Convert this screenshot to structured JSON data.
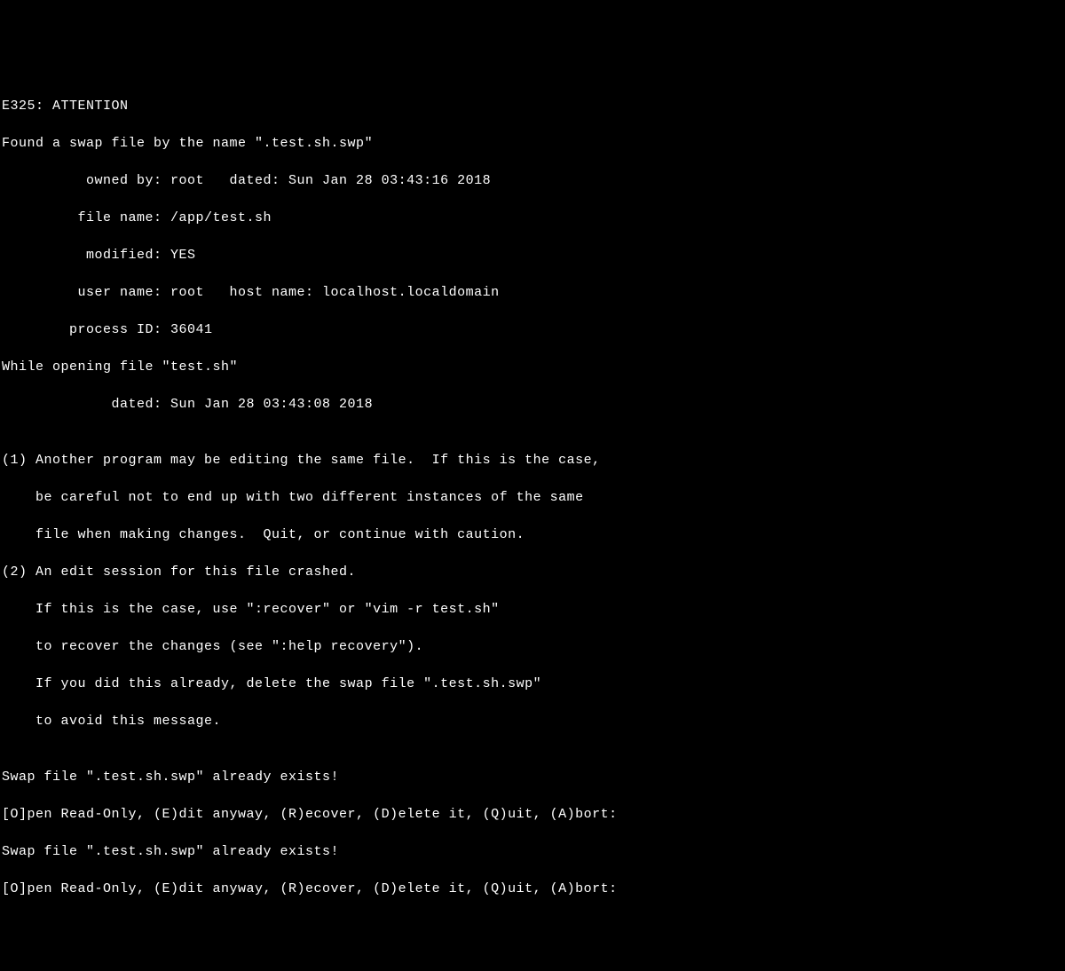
{
  "lines": {
    "l0": "E325: ATTENTION",
    "l1": "Found a swap file by the name \".test.sh.swp\"",
    "l2": "          owned by: root   dated: Sun Jan 28 03:43:16 2018",
    "l3": "         file name: /app/test.sh",
    "l4": "          modified: YES",
    "l5": "         user name: root   host name: localhost.localdomain",
    "l6": "        process ID: 36041",
    "l7": "While opening file \"test.sh\"",
    "l8": "             dated: Sun Jan 28 03:43:08 2018",
    "l9": "",
    "l10": "(1) Another program may be editing the same file.  If this is the case,",
    "l11": "    be careful not to end up with two different instances of the same",
    "l12": "    file when making changes.  Quit, or continue with caution.",
    "l13": "(2) An edit session for this file crashed.",
    "l14": "    If this is the case, use \":recover\" or \"vim -r test.sh\"",
    "l15": "    to recover the changes (see \":help recovery\").",
    "l16": "    If you did this already, delete the swap file \".test.sh.swp\"",
    "l17": "    to avoid this message.",
    "l18": "",
    "l19": "Swap file \".test.sh.swp\" already exists!",
    "l20": "[O]pen Read-Only, (E)dit anyway, (R)ecover, (D)elete it, (Q)uit, (A)bort:",
    "l21": "Swap file \".test.sh.swp\" already exists!",
    "l22": "[O]pen Read-Only, (E)dit anyway, (R)ecover, (D)elete it, (Q)uit, (A)bort:"
  }
}
